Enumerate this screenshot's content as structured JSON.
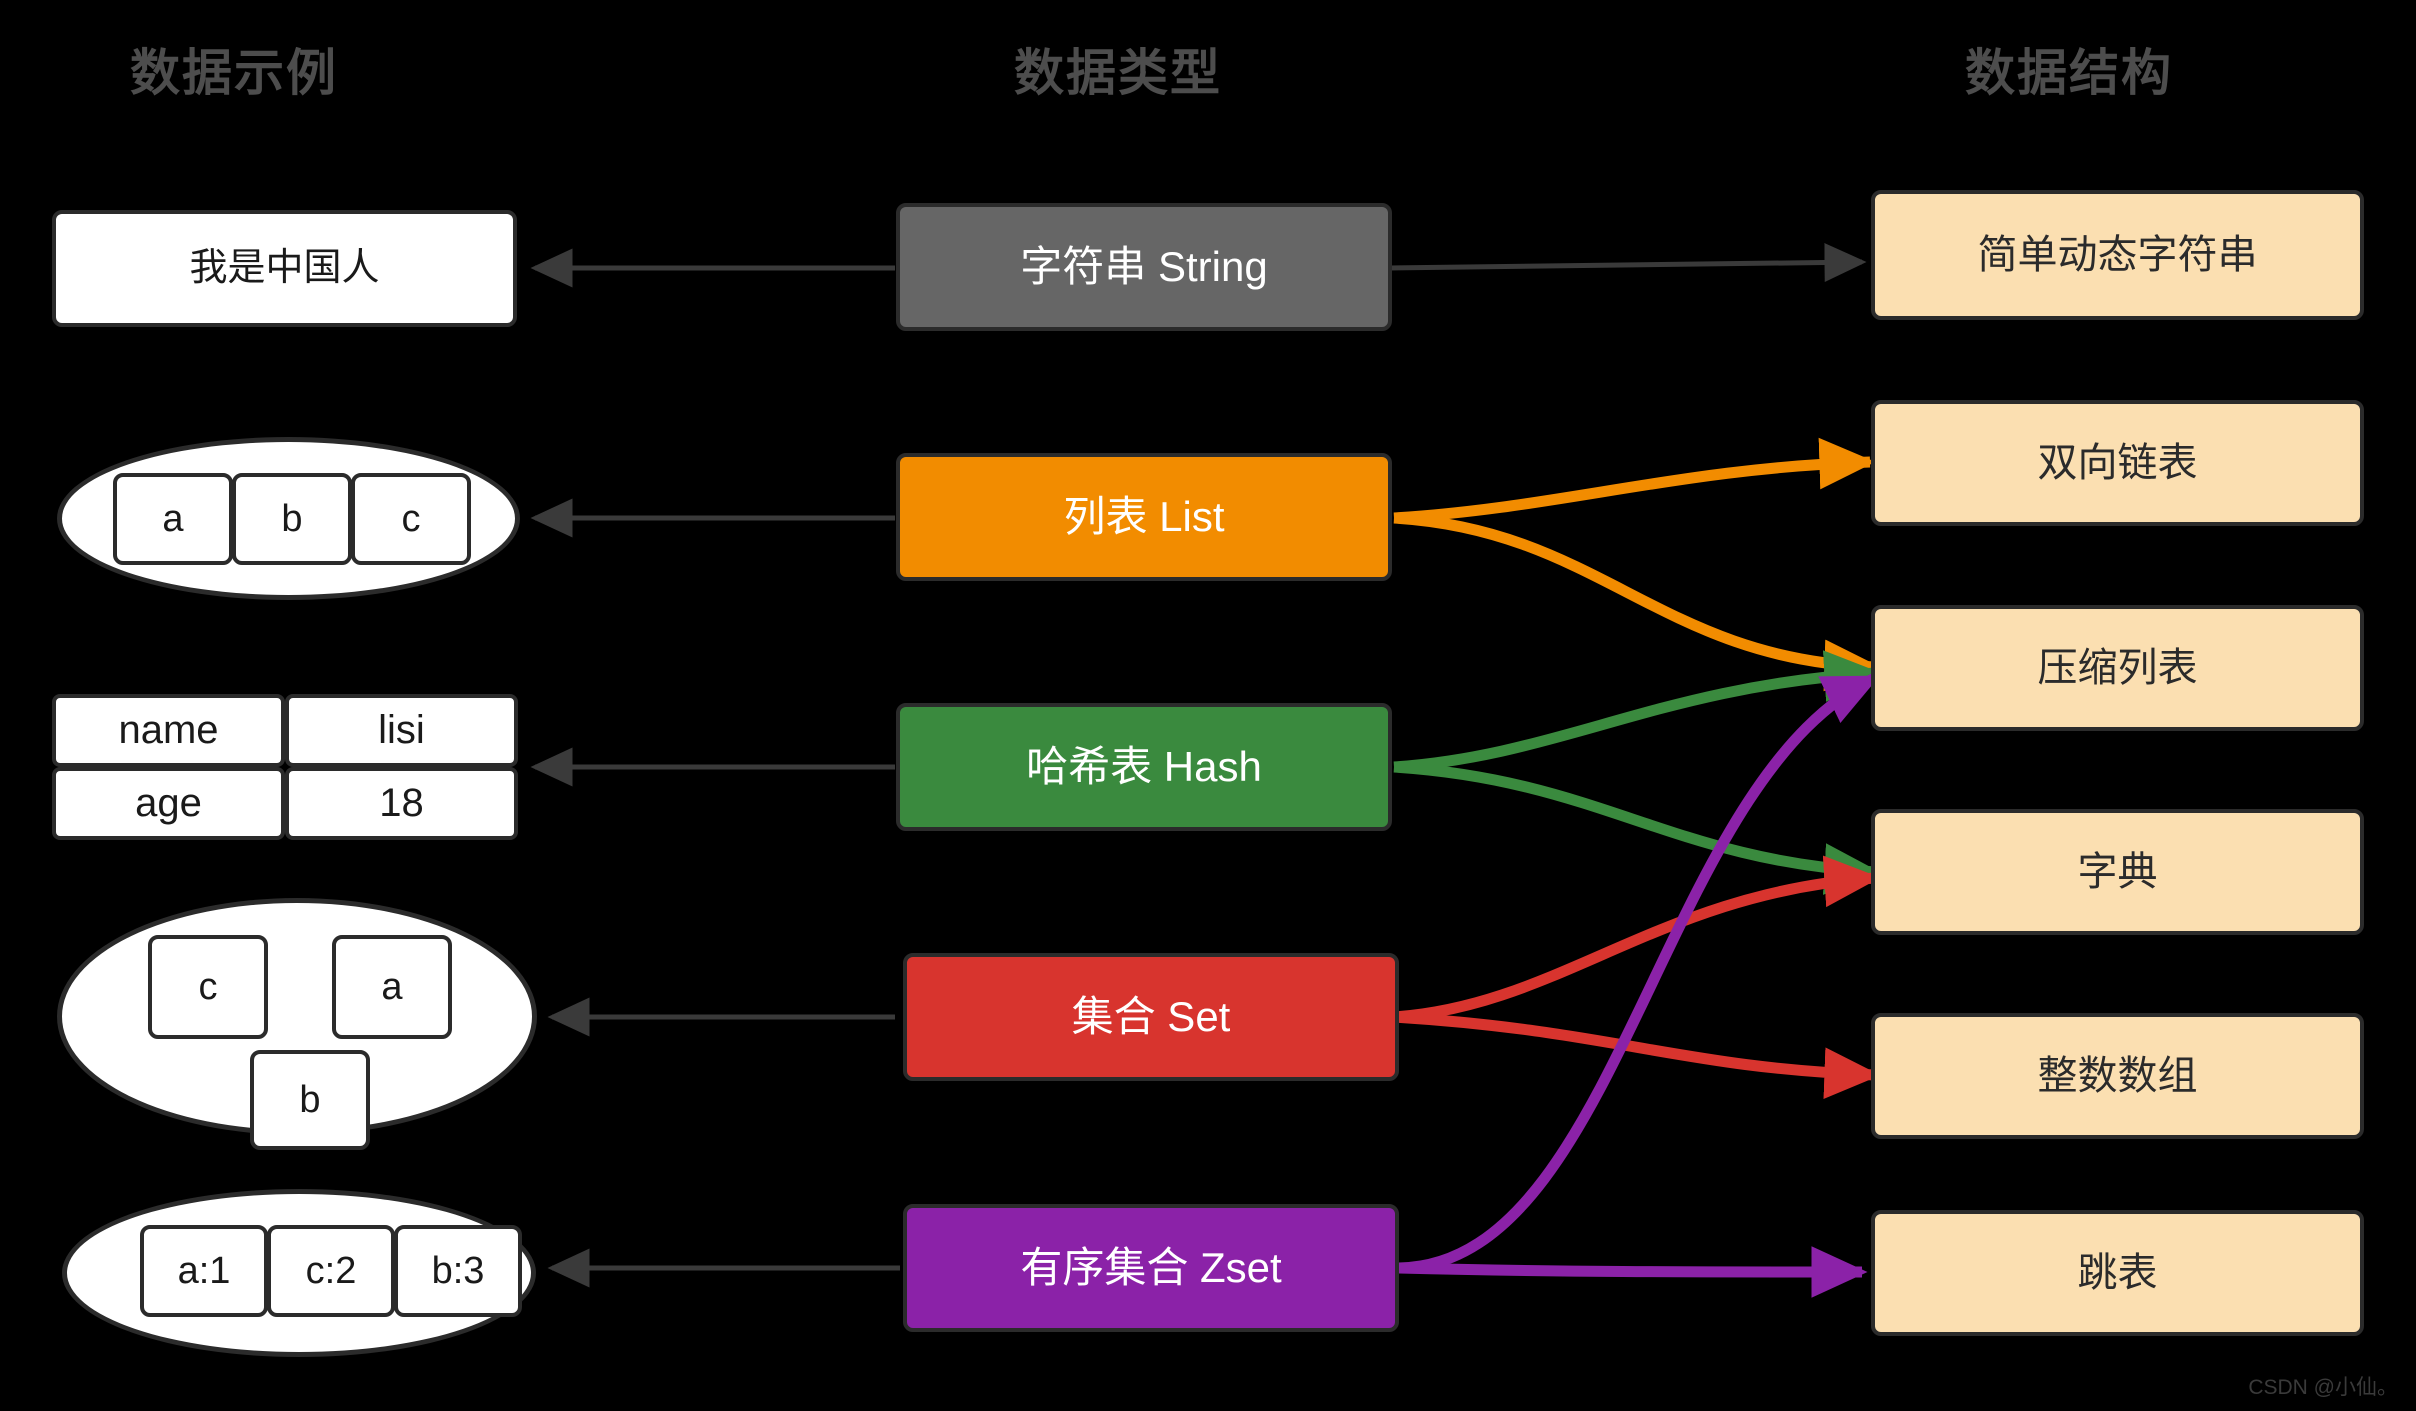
{
  "headers": {
    "examples": "数据示例",
    "types": "数据类型",
    "structures": "数据结构"
  },
  "examples": {
    "string": {
      "text": "我是中国人"
    },
    "list": {
      "cells": [
        "a",
        "b",
        "c"
      ]
    },
    "hash": {
      "rows": [
        {
          "key": "name",
          "value": "lisi"
        },
        {
          "key": "age",
          "value": "18"
        }
      ]
    },
    "set": {
      "cells": [
        "c",
        "a",
        "b"
      ]
    },
    "zset": {
      "cells": [
        "a:1",
        "c:2",
        "b:3"
      ]
    }
  },
  "types": [
    {
      "label": "字符串 String",
      "color": "#666666"
    },
    {
      "label": "列表 List",
      "color": "#f28c00"
    },
    {
      "label": "哈希表 Hash",
      "color": "#3a8a3e"
    },
    {
      "label": "集合 Set",
      "color": "#d8342e"
    },
    {
      "label": "有序集合 Zset",
      "color": "#8b22a8"
    }
  ],
  "structures": [
    {
      "label": "简单动态字符串"
    },
    {
      "label": "双向链表"
    },
    {
      "label": "压缩列表"
    },
    {
      "label": "字典"
    },
    {
      "label": "整数数组"
    },
    {
      "label": "跳表"
    }
  ],
  "connections": [
    {
      "from": "字符串 String",
      "to": "简单动态字符串",
      "color": "#5a5a5a"
    },
    {
      "from": "列表 List",
      "to": "双向链表",
      "color": "#f28c00"
    },
    {
      "from": "列表 List",
      "to": "压缩列表",
      "color": "#f28c00"
    },
    {
      "from": "哈希表 Hash",
      "to": "压缩列表",
      "color": "#3a8a3e"
    },
    {
      "from": "哈希表 Hash",
      "to": "字典",
      "color": "#3a8a3e"
    },
    {
      "from": "集合 Set",
      "to": "字典",
      "color": "#d8342e"
    },
    {
      "from": "集合 Set",
      "to": "整数数组",
      "color": "#d8342e"
    },
    {
      "from": "有序集合 Zset",
      "to": "压缩列表",
      "color": "#8b22a8"
    },
    {
      "from": "有序集合 Zset",
      "to": "跳表",
      "color": "#8b22a8"
    }
  ],
  "watermark": "CSDN @小仙。"
}
